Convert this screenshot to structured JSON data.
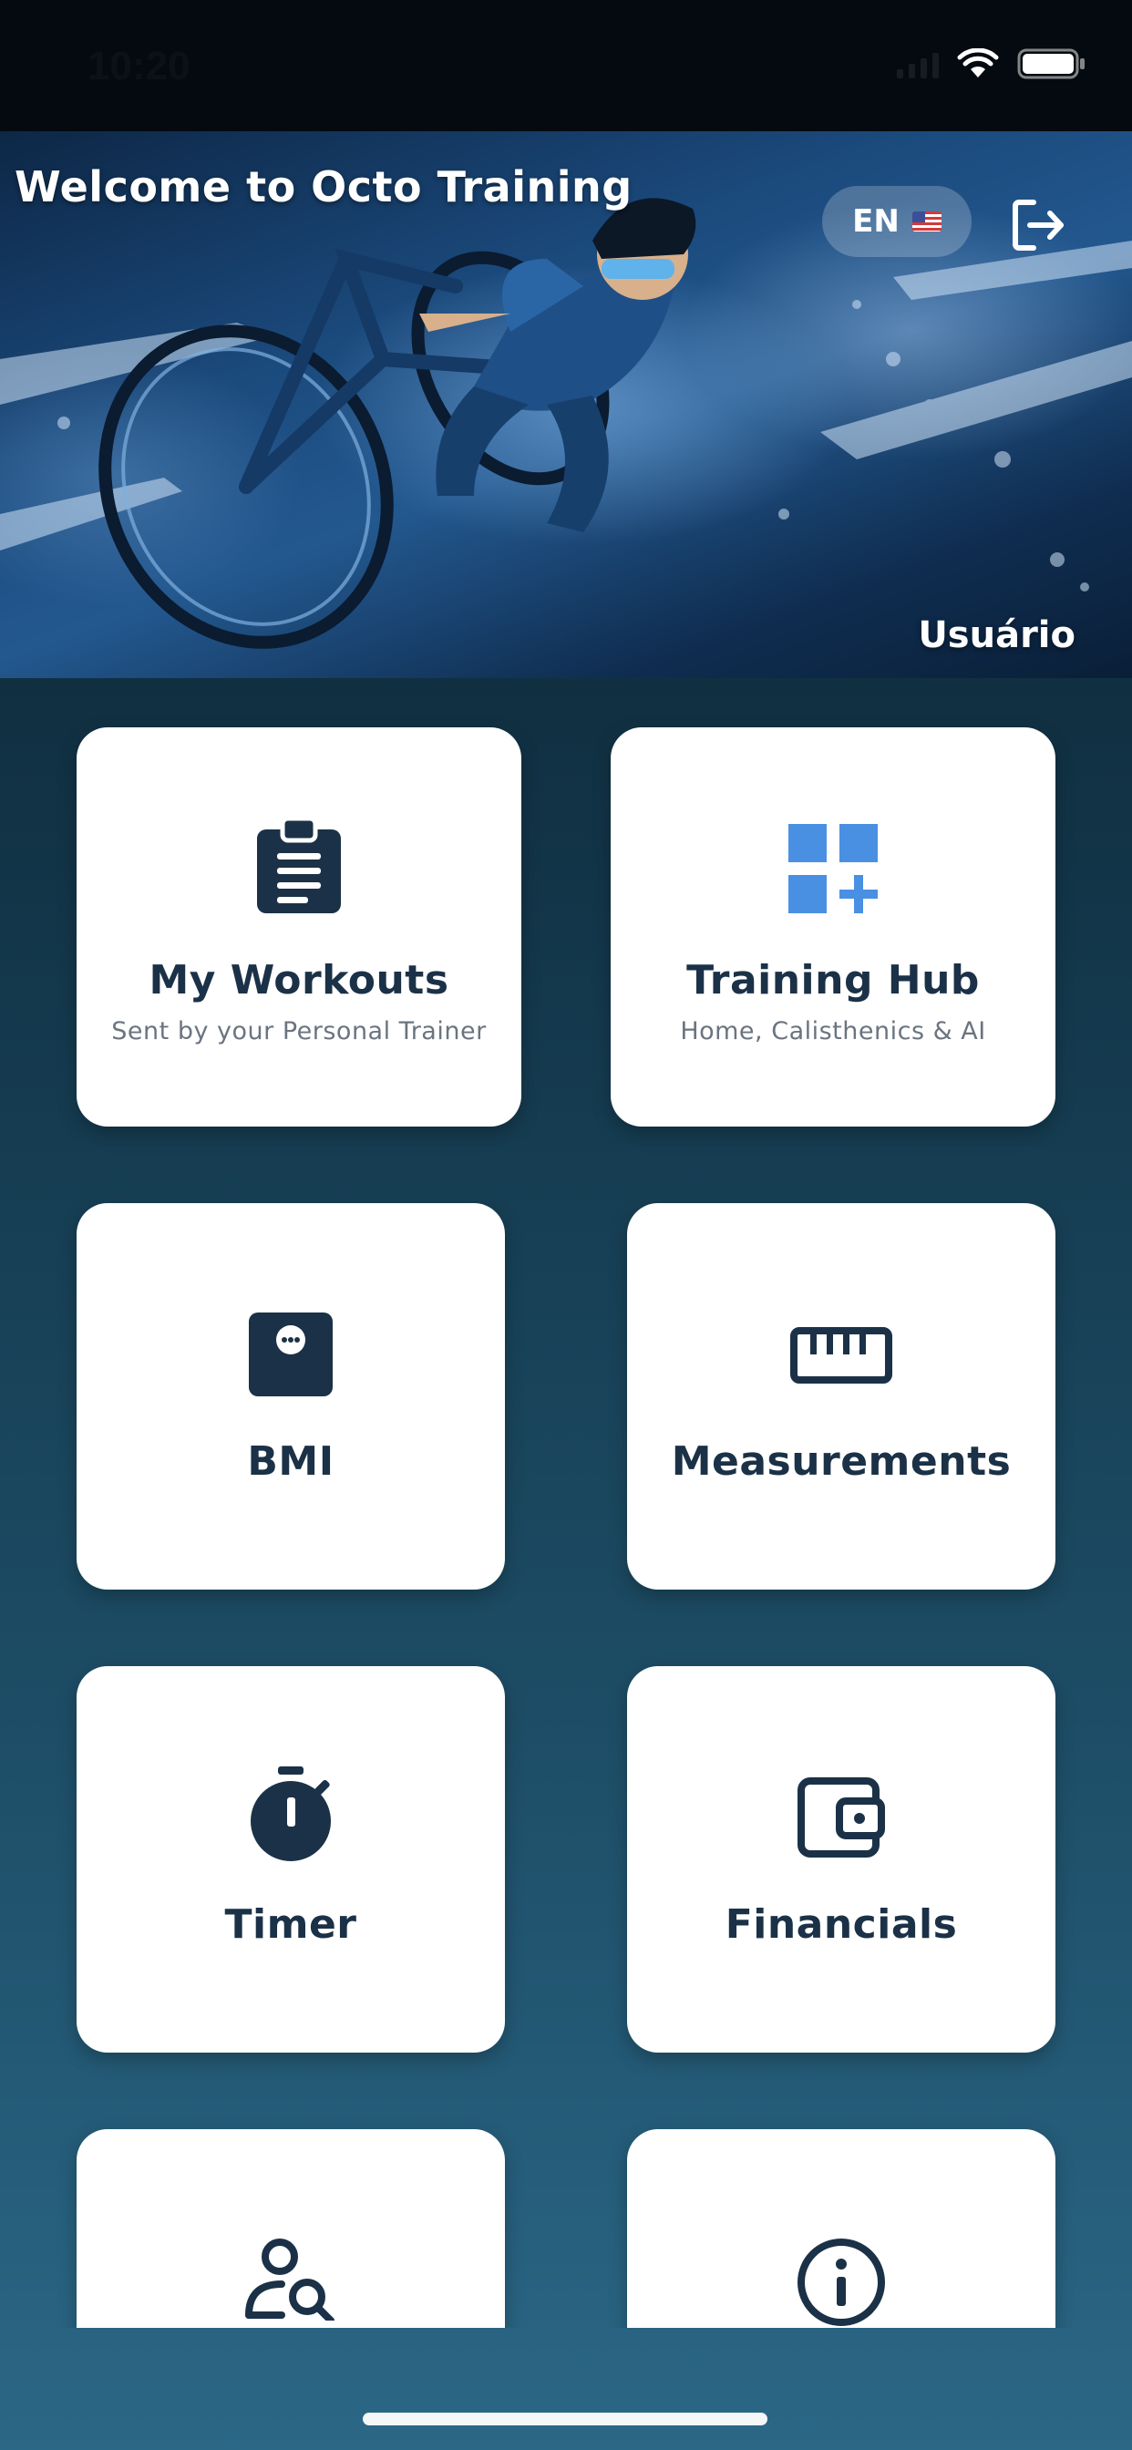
{
  "status_bar": {
    "time": "10:20"
  },
  "header": {
    "title": "Welcome to Octo Training",
    "language_code": "EN",
    "language_flag_icon": "us-flag-icon",
    "logout_icon": "logout-icon",
    "user_name": "Usuário"
  },
  "menu": {
    "my_workouts": {
      "title": "My Workouts",
      "subtitle": "Sent by your Personal Trainer",
      "icon": "clipboard-icon"
    },
    "training_hub": {
      "title": "Training Hub",
      "subtitle": "Home, Calisthenics & AI",
      "icon": "grid-plus-icon"
    },
    "bmi": {
      "title": "BMI",
      "icon": "scale-icon"
    },
    "measurements": {
      "title": "Measurements",
      "icon": "ruler-icon"
    },
    "timer": {
      "title": "Timer",
      "icon": "stopwatch-icon"
    },
    "financials": {
      "title": "Financials",
      "icon": "wallet-icon"
    },
    "trainer_search": {
      "icon": "person-search-icon"
    },
    "info": {
      "icon": "info-icon"
    }
  },
  "colors": {
    "card_text": "#1b3147",
    "accent_blue": "#4a90e2",
    "card_bg": "#ffffff"
  }
}
